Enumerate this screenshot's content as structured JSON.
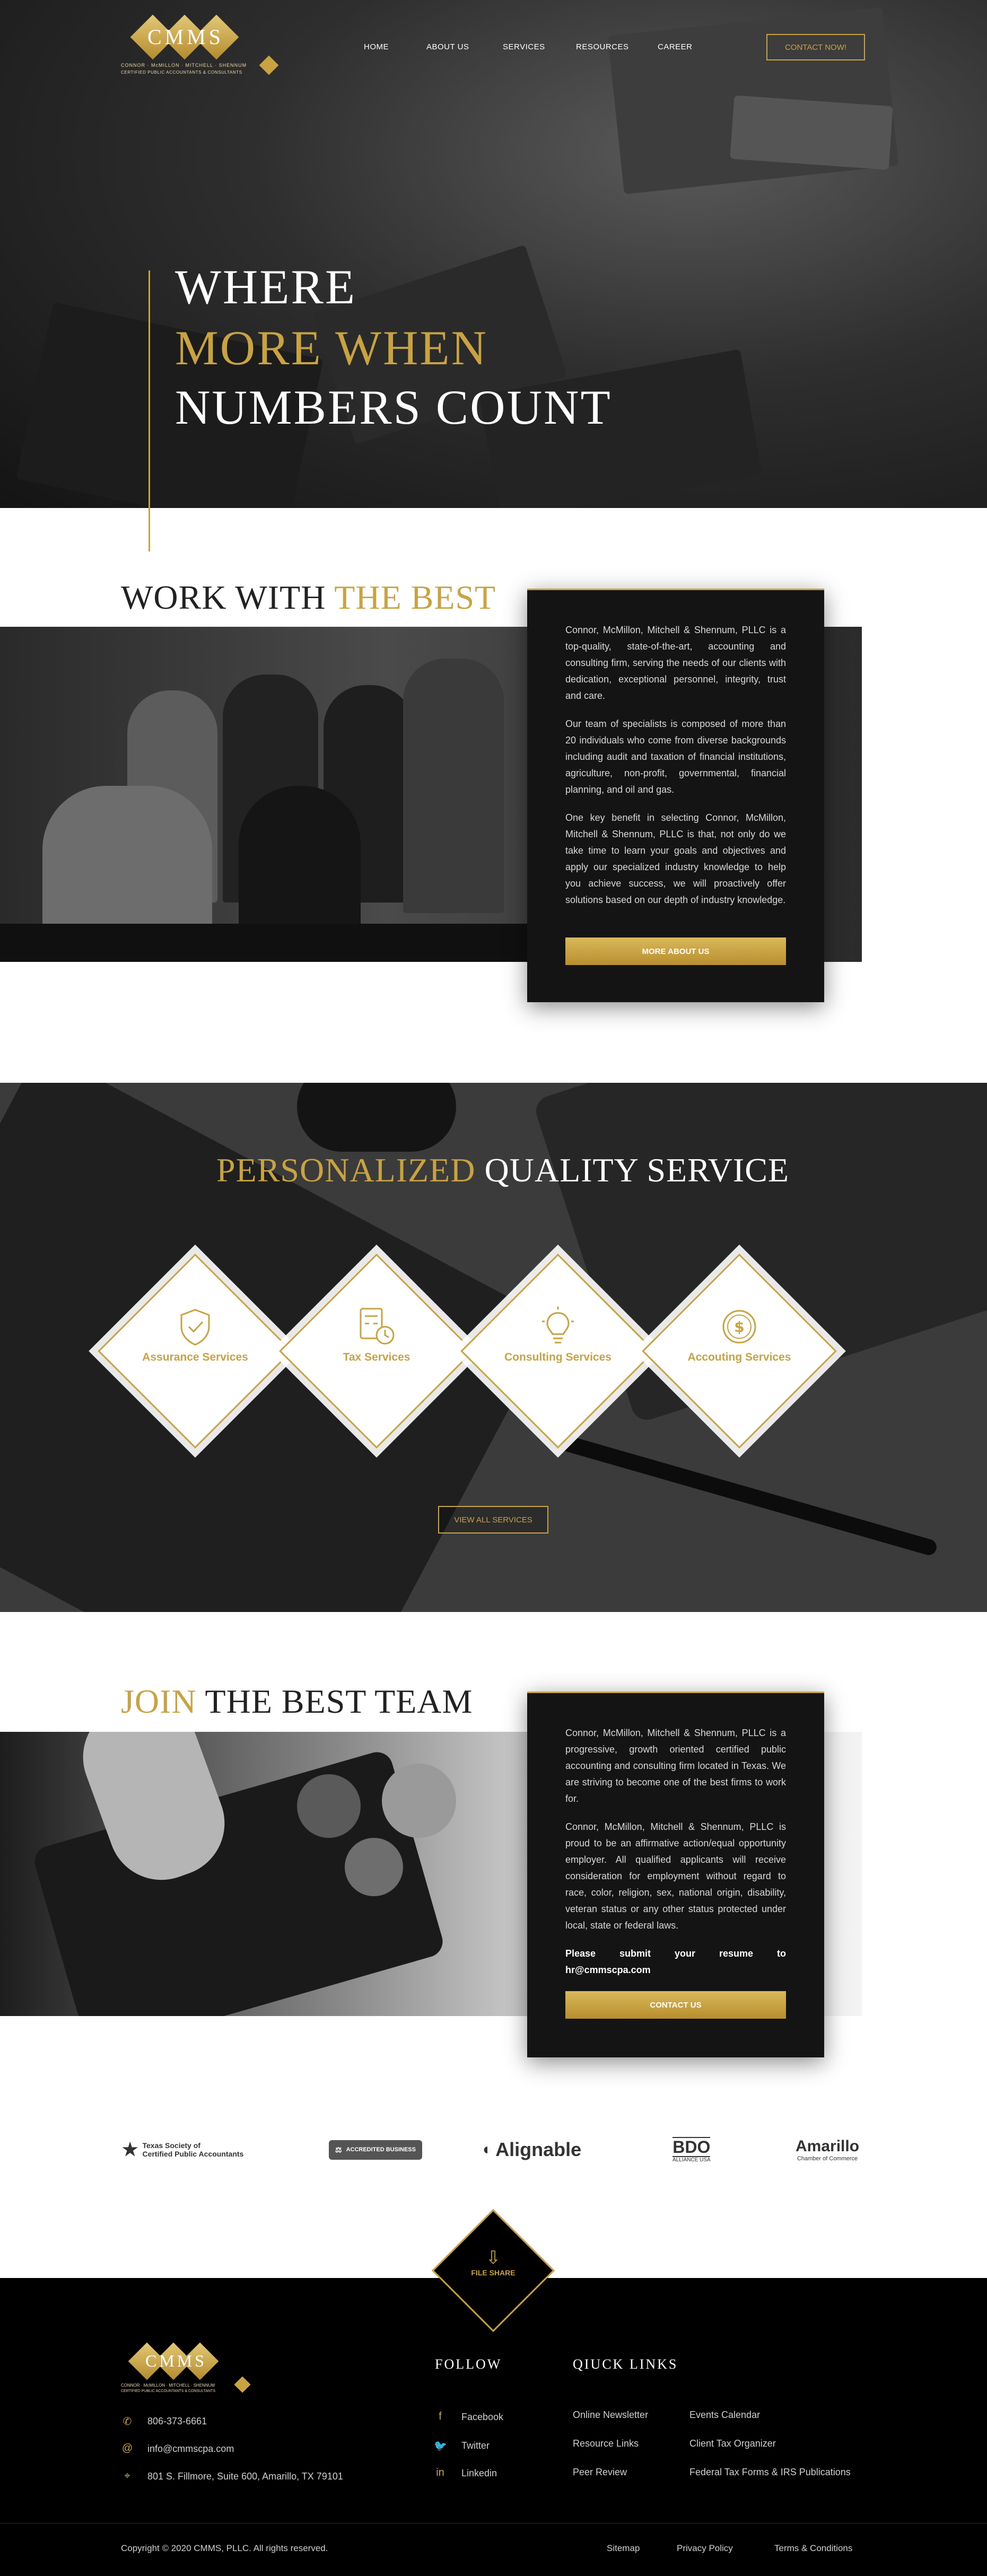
{
  "brand": {
    "logo_text": "CMMS",
    "logo_subline": "CONNOR · McMILLON · MITCHELL · SHENNUM",
    "logo_tagline": "CERTIFIED PUBLIC ACCOUNTANTS & CONSULTANTS"
  },
  "nav": {
    "items": [
      {
        "label": "HOME"
      },
      {
        "label": "ABOUT US"
      },
      {
        "label": "SERVICES"
      },
      {
        "label": "RESOURCES"
      },
      {
        "label": "CAREER"
      }
    ],
    "cta_label": "CONTACT NOW!"
  },
  "hero": {
    "line1": "WHERE",
    "line2": "MORE WHEN",
    "line3": "NUMBERS COUNT"
  },
  "work": {
    "title_a": "WORK WITH",
    "title_b": "THE BEST",
    "paragraphs": [
      "Connor, McMillon, Mitchell & Shennum, PLLC is a top-quality, state-of-the-art, accounting and consulting firm, serving the needs of our clients with dedication, exceptional personnel, integrity, trust and care.",
      "Our team of specialists is composed of more than 20 individuals who come from diverse backgrounds including audit and taxation of financial institutions, agriculture, non-profit, governmental, financial planning, and oil and gas.",
      "One key benefit in selecting Connor, McMillon, Mitchell & Shennum, PLLC is that, not only do we take time to learn your goals and objectives and apply our specialized industry knowledge to help you achieve success, we will proactively offer solutions based on our depth of industry knowledge."
    ],
    "button_label": "MORE ABOUT US"
  },
  "services": {
    "title_a": "PERSONALIZED",
    "title_b": "QUALITY SERVICE",
    "items": [
      {
        "label": "Assurance Services",
        "icon": "shield-icon"
      },
      {
        "label": "Tax Services",
        "icon": "calculator-clock-icon"
      },
      {
        "label": "Consulting Services",
        "icon": "lightbulb-icon"
      },
      {
        "label": "Accouting Services",
        "icon": "coin-icon"
      }
    ],
    "button_label": "VIEW ALL SERVICES"
  },
  "join": {
    "title_a": "JOIN",
    "title_b": "THE BEST TEAM",
    "paragraphs": [
      "Connor, McMillon, Mitchell & Shennum, PLLC is a progressive, growth oriented certified public accounting and consulting firm located in Texas. We are striving to become one of the best firms to work for.",
      "Connor, McMillon, Mitchell & Shennum, PLLC is proud to be an affirmative action/equal opportunity employer. All qualified applicants will receive consideration for employment without regard to race, color, religion, sex, national origin, disability, veteran status or any other status protected under local, state or federal laws."
    ],
    "resume_note": "Please submit your resume to hr@cmmscpa.com",
    "button_label": "CONTACT US"
  },
  "partners": {
    "tscpa_line1": "Texas Society of",
    "tscpa_line2": "Certified Public Accountants",
    "bbb": "ACCREDITED BUSINESS",
    "alignable": "Alignable",
    "bdo": "BDO",
    "bdo_sub": "ALLIANCE USA",
    "amarillo": "Amarillo",
    "amarillo_sub": "Chamber of Commerce"
  },
  "file_share": {
    "label": "FILE SHARE"
  },
  "footer": {
    "phone": "806-373-6661",
    "email": "info@cmmscpa.com",
    "address": "801 S. Fillmore, Suite 600, Amarillo, TX 79101",
    "follow_title": "FOLLOW",
    "social": [
      {
        "label": "Facebook"
      },
      {
        "label": "Twitter"
      },
      {
        "label": "Linkedin"
      }
    ],
    "quick_title": "QIUCK LINKS",
    "quick_links_col1": [
      {
        "label": "Online Newsletter"
      },
      {
        "label": "Resource Links"
      },
      {
        "label": "Peer Review"
      }
    ],
    "quick_links_col2": [
      {
        "label": "Events Calendar"
      },
      {
        "label": "Client Tax Organizer"
      },
      {
        "label": "Federal Tax Forms & IRS Publications"
      }
    ],
    "copyright": "Copyright © 2020 CMMS, PLLC. All rights reserved.",
    "bottom_links": [
      {
        "label": "Sitemap"
      },
      {
        "label": "Privacy Policy"
      },
      {
        "label": "Terms & Conditions"
      }
    ]
  },
  "colors": {
    "accent_gold": "#c9a342",
    "dark": "#141414",
    "footer": "#000000"
  }
}
